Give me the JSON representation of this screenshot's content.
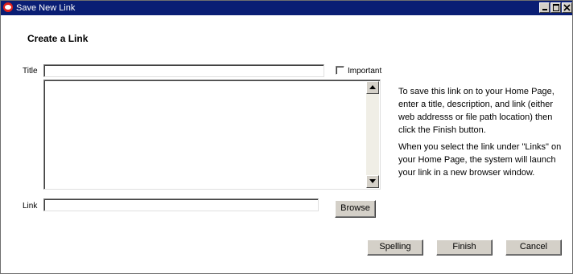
{
  "window": {
    "title": "Save New Link",
    "icon": "oracle-logo-icon"
  },
  "form": {
    "heading": "Create a Link",
    "title_label": "Title",
    "title_value": "",
    "important_label": "Important",
    "important_checked": false,
    "description_value": "",
    "link_label": "Link",
    "link_value": "",
    "browse_label": "Browse"
  },
  "help": {
    "paragraph1": "To save this link on to your Home Page, enter a title, description, and link (either web addresss or file path location) then click the Finish button.",
    "paragraph2": "When you select the link under \"Links\" on your Home Page, the system will launch your link in a new browser window."
  },
  "buttons": {
    "spelling": "Spelling",
    "finish": "Finish",
    "cancel": "Cancel"
  }
}
